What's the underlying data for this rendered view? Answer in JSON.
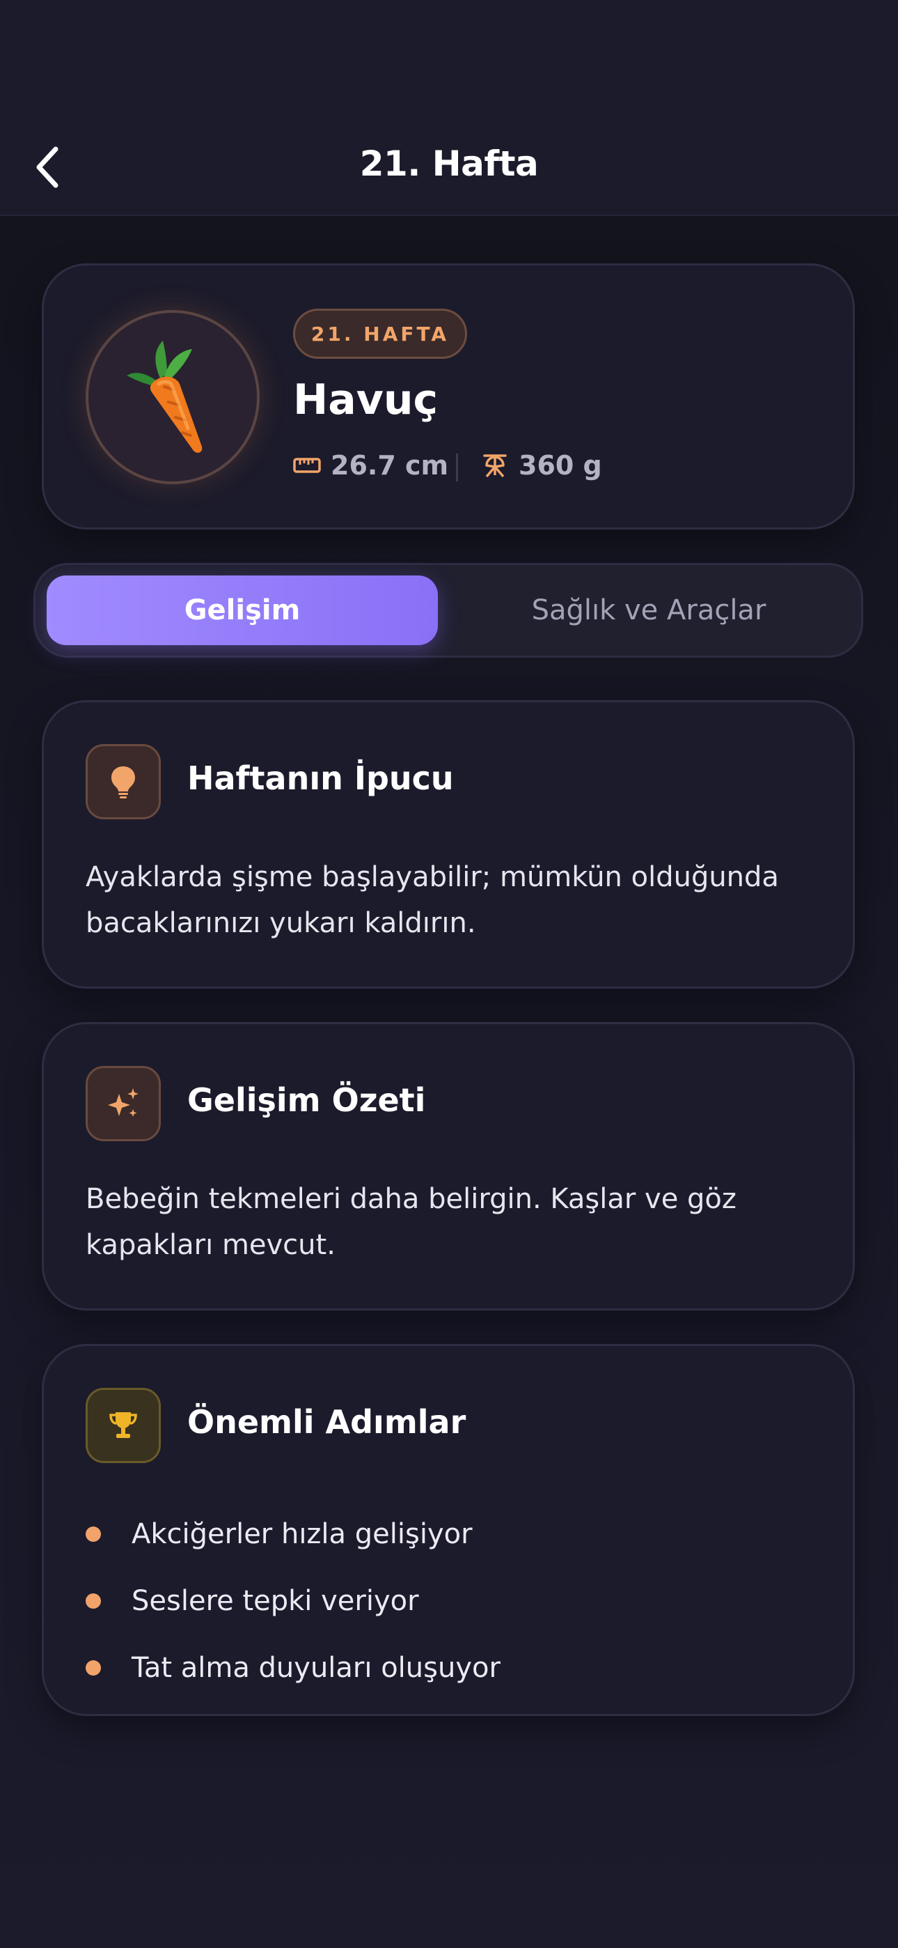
{
  "header": {
    "title": "21. Hafta"
  },
  "hero": {
    "badge": "21. HAFTA",
    "fruit_name": "Havuç",
    "fruit_icon": "carrot",
    "length": "26.7 cm",
    "weight": "360 g"
  },
  "tabs": [
    {
      "label": "Gelişim",
      "active": true
    },
    {
      "label": "Sağlık ve Araçlar",
      "active": false
    }
  ],
  "tip": {
    "title": "Haftanın İpucu",
    "text": "Ayaklarda şişme başlayabilir; mümkün olduğunda bacaklarınızı yukarı kaldırın.",
    "icon": "lightbulb-icon"
  },
  "summary": {
    "title": "Gelişim Özeti",
    "text": "Bebeğin tekmeleri daha belirgin. Kaşlar ve göz kapakları mevcut.",
    "icon": "sparkles-icon"
  },
  "milestones": {
    "title": "Önemli Adımlar",
    "icon": "trophy-icon",
    "items": [
      "Akciğerler hızla gelişiyor",
      "Seslere tepki veriyor",
      "Tat alma duyuları oluşuyor"
    ]
  },
  "colors": {
    "accent_purple": "#9b84ff",
    "accent_orange": "#f2a56a",
    "accent_gold": "#f0b429",
    "background": "#171726"
  }
}
